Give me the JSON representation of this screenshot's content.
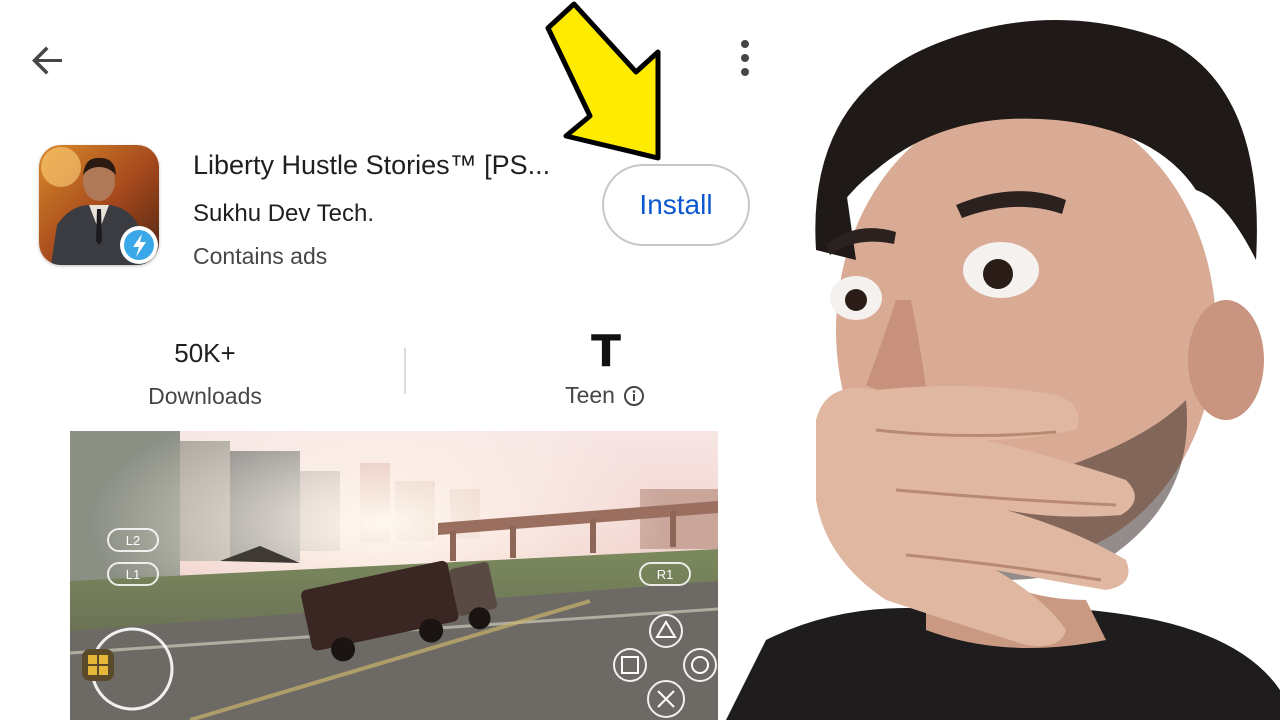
{
  "app": {
    "title": "Liberty Hustle Stories™ [PS...",
    "developer": "Sukhu Dev Tech.",
    "ads_note": "Contains ads",
    "install_label": "Install"
  },
  "stats": {
    "downloads_value": "50K+",
    "downloads_label": "Downloads",
    "rating_badge": "T",
    "rating_label": "Teen"
  },
  "screenshot": {
    "buttons": {
      "l2": "L2",
      "l1": "L1",
      "r1": "R1"
    }
  },
  "colors": {
    "accent": "#0b57d0",
    "arrow": "#ffeb00",
    "text": "#1f1f1f"
  },
  "icons": [
    "back-arrow-icon",
    "more-vert-icon",
    "info-icon",
    "triangle-icon",
    "square-icon",
    "circle-icon",
    "cross-icon"
  ]
}
